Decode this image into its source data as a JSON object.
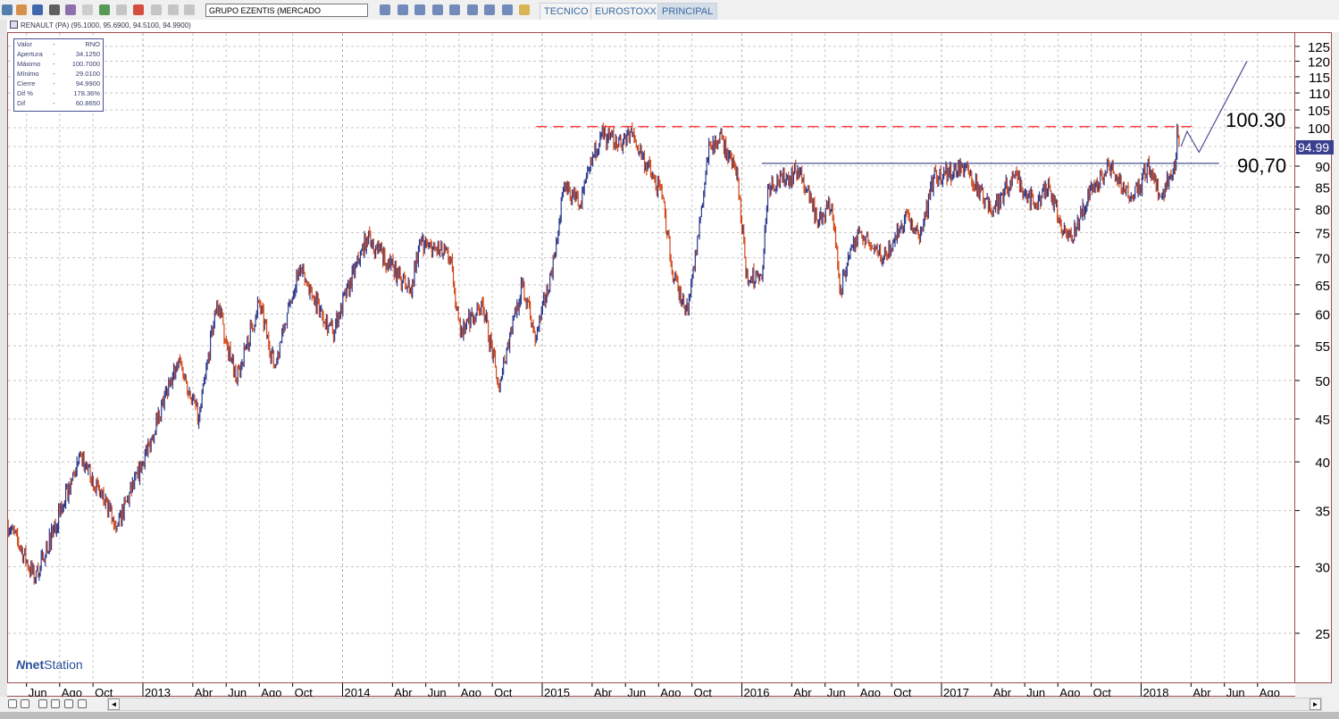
{
  "toolbar": {
    "market_select": "GRUPO EZENTIS (MERCADO CONTINUO)",
    "tabs": [
      {
        "label": "TECNICO",
        "active": false
      },
      {
        "label": "EUROSTOXX",
        "active": false
      },
      {
        "label": "PRINCIPAL",
        "active": true
      }
    ]
  },
  "window": {
    "title": "RENAULT (PA) (95.1000, 95.6900, 94.5100, 94.9900)"
  },
  "infobox": {
    "rows": [
      {
        "k": "Valor",
        "v": "RNO"
      },
      {
        "k": "Apertura",
        "v": "34.1250"
      },
      {
        "k": "Máximo",
        "v": "100.7000"
      },
      {
        "k": "Mínimo",
        "v": "29.0100"
      },
      {
        "k": "Cierre",
        "v": "94.9900"
      },
      {
        "k": "Dif %",
        "v": "178.36%"
      },
      {
        "k": "Dif",
        "v": "60.8650"
      }
    ],
    "sep": "-"
  },
  "logo": {
    "n": "N",
    "text_bold": "net",
    "text": "Station"
  },
  "bottom_bar": {
    "scroll_left": "◄",
    "scroll_right": "►"
  },
  "colors": {
    "up": "#2d3a8c",
    "down": "#d2481a",
    "resistance": "#ff2020",
    "support": "#4a4f8f",
    "grid": "#c8c8c8",
    "border": "#a05050"
  },
  "chart_data": {
    "type": "line",
    "title": "RENAULT (PA)",
    "yscale": "log",
    "ylim": [
      22,
      130
    ],
    "xlim": [
      2012.32,
      2018.77
    ],
    "yticks": [
      25,
      30,
      35,
      40,
      45,
      50,
      55,
      60,
      65,
      70,
      75,
      80,
      85,
      90,
      95,
      100,
      105,
      110,
      115,
      120,
      125
    ],
    "xticks": [
      {
        "t": 2012.417,
        "label": "Jun"
      },
      {
        "t": 2012.583,
        "label": "Ago"
      },
      {
        "t": 2012.75,
        "label": "Oct"
      },
      {
        "t": 2013.0,
        "label": "2013"
      },
      {
        "t": 2013.25,
        "label": "Abr"
      },
      {
        "t": 2013.417,
        "label": "Jun"
      },
      {
        "t": 2013.583,
        "label": "Ago"
      },
      {
        "t": 2013.75,
        "label": "Oct"
      },
      {
        "t": 2014.0,
        "label": "2014"
      },
      {
        "t": 2014.25,
        "label": "Abr"
      },
      {
        "t": 2014.417,
        "label": "Jun"
      },
      {
        "t": 2014.583,
        "label": "Ago"
      },
      {
        "t": 2014.75,
        "label": "Oct"
      },
      {
        "t": 2015.0,
        "label": "2015"
      },
      {
        "t": 2015.25,
        "label": "Abr"
      },
      {
        "t": 2015.417,
        "label": "Jun"
      },
      {
        "t": 2015.583,
        "label": "Ago"
      },
      {
        "t": 2015.75,
        "label": "Oct"
      },
      {
        "t": 2016.0,
        "label": "2016"
      },
      {
        "t": 2016.25,
        "label": "Abr"
      },
      {
        "t": 2016.417,
        "label": "Jun"
      },
      {
        "t": 2016.583,
        "label": "Ago"
      },
      {
        "t": 2016.75,
        "label": "Oct"
      },
      {
        "t": 2017.0,
        "label": "2017"
      },
      {
        "t": 2017.25,
        "label": "Abr"
      },
      {
        "t": 2017.417,
        "label": "Jun"
      },
      {
        "t": 2017.583,
        "label": "Ago"
      },
      {
        "t": 2017.75,
        "label": "Oct"
      },
      {
        "t": 2018.0,
        "label": "2018"
      },
      {
        "t": 2018.25,
        "label": "Abr"
      },
      {
        "t": 2018.417,
        "label": "Jun"
      },
      {
        "t": 2018.583,
        "label": "Ago"
      }
    ],
    "series": [
      {
        "name": "RNO",
        "points": [
          [
            2012.32,
            34
          ],
          [
            2012.46,
            29
          ],
          [
            2012.69,
            40.6
          ],
          [
            2012.87,
            33.5
          ],
          [
            2013.0,
            40
          ],
          [
            2013.18,
            53
          ],
          [
            2013.28,
            45
          ],
          [
            2013.37,
            62
          ],
          [
            2013.47,
            50
          ],
          [
            2013.58,
            62
          ],
          [
            2013.66,
            52
          ],
          [
            2013.78,
            68
          ],
          [
            2013.95,
            57
          ],
          [
            2014.12,
            74
          ],
          [
            2014.34,
            64
          ],
          [
            2014.39,
            73
          ],
          [
            2014.54,
            70
          ],
          [
            2014.59,
            57
          ],
          [
            2014.7,
            62
          ],
          [
            2014.78,
            49.5
          ],
          [
            2014.9,
            65
          ],
          [
            2014.97,
            56
          ],
          [
            2015.06,
            70
          ],
          [
            2015.11,
            85
          ],
          [
            2015.19,
            81
          ],
          [
            2015.29,
            98
          ],
          [
            2015.42,
            96
          ],
          [
            2015.44,
            99
          ],
          [
            2015.6,
            83
          ],
          [
            2015.66,
            66
          ],
          [
            2015.73,
            60
          ],
          [
            2015.84,
            96
          ],
          [
            2015.9,
            97
          ],
          [
            2015.98,
            87
          ],
          [
            2016.02,
            67
          ],
          [
            2016.1,
            66
          ],
          [
            2016.13,
            85
          ],
          [
            2016.29,
            89
          ],
          [
            2016.38,
            77
          ],
          [
            2016.45,
            81
          ],
          [
            2016.49,
            64
          ],
          [
            2016.58,
            75
          ],
          [
            2016.71,
            70
          ],
          [
            2016.83,
            79
          ],
          [
            2016.89,
            73
          ],
          [
            2016.96,
            87
          ],
          [
            2017.12,
            90
          ],
          [
            2017.25,
            79
          ],
          [
            2017.36,
            88
          ],
          [
            2017.47,
            81
          ],
          [
            2017.54,
            85
          ],
          [
            2017.61,
            75
          ],
          [
            2017.65,
            74
          ],
          [
            2017.77,
            86
          ],
          [
            2017.85,
            90
          ],
          [
            2017.92,
            84
          ],
          [
            2017.99,
            84
          ],
          [
            2018.03,
            90
          ],
          [
            2018.09,
            83
          ],
          [
            2018.17,
            89
          ],
          [
            2018.18,
            100.3
          ],
          [
            2018.19,
            94.99
          ]
        ]
      }
    ],
    "last_price": "94.99",
    "annotations": [
      {
        "type": "hline",
        "name": "resistance",
        "value": 100.3,
        "from": 2014.97,
        "to": 2018.28,
        "style": "dashed",
        "label": "100.30"
      },
      {
        "type": "hline",
        "name": "support",
        "value": 90.7,
        "from": 2016.1,
        "to": 2018.39,
        "style": "solid",
        "label": "90,70"
      },
      {
        "type": "projection",
        "points": [
          [
            2018.2,
            95
          ],
          [
            2018.23,
            99
          ],
          [
            2018.29,
            93.5
          ],
          [
            2018.53,
            120
          ]
        ]
      }
    ]
  }
}
